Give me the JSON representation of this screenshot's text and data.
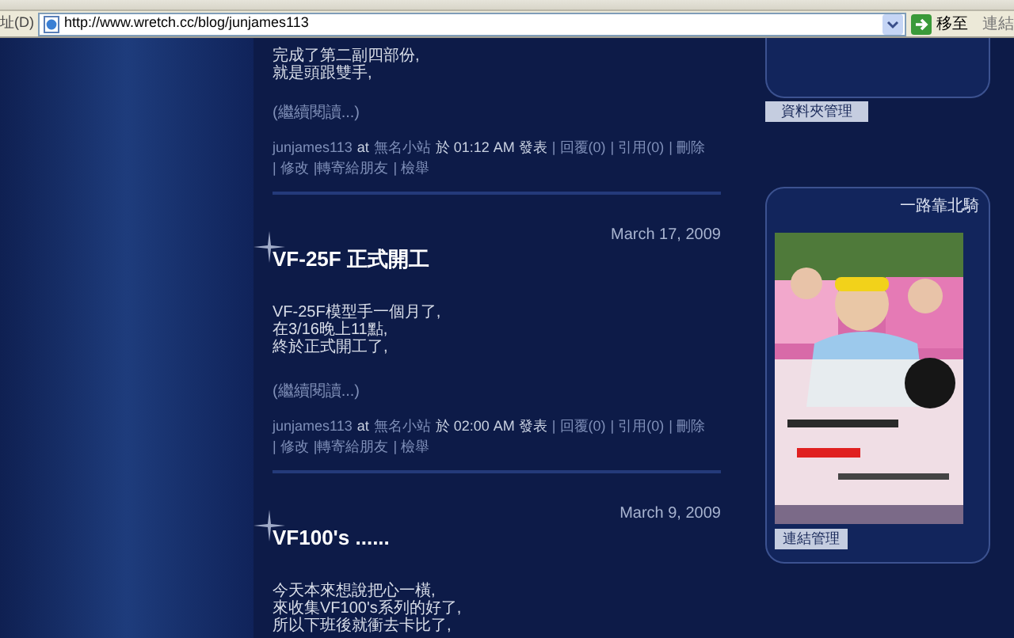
{
  "browser": {
    "address_label": "址(D)",
    "url": "http://www.wretch.cc/blog/junjames113",
    "go_button": "移至",
    "links_label": "連結"
  },
  "posts": [
    {
      "kind": "partial",
      "body": [
        "完成了第二副四部份,",
        "就是頭跟雙手,"
      ],
      "read_more": "(繼續閱讀...)",
      "meta": {
        "author": "junjames113",
        "at": "at",
        "site": "無名小站",
        "time": "於 01:12 AM 發表",
        "actions": [
          "| 回覆(0)",
          "| 引用(0)",
          "| 刪除",
          "| 修改",
          "|轉寄給朋友",
          "| 檢舉"
        ]
      }
    },
    {
      "kind": "full",
      "date": "March 17, 2009",
      "title": "VF-25F 正式開工",
      "body": [
        "VF-25F模型手一個月了,",
        "在3/16晚上11點,",
        "終於正式開工了,"
      ],
      "read_more": "(繼續閱讀...)",
      "meta": {
        "author": "junjames113",
        "at": "at",
        "site": "無名小站",
        "time": "於 02:00 AM 發表",
        "actions": [
          "| 回覆(0)",
          "| 引用(0)",
          "| 刪除",
          "| 修改",
          "|轉寄給朋友",
          "| 檢舉"
        ]
      }
    },
    {
      "kind": "full",
      "date": "March 9, 2009",
      "title": "VF100's ......",
      "body": [
        "今天本來想說把心一橫,",
        "來收集VF100's系列的好了,",
        "所以下班後就衝去卡比了,"
      ]
    }
  ],
  "sidebar": {
    "folder_button": "資料夾管理",
    "panel": {
      "title": "一路靠北騎",
      "button": "連結管理"
    }
  }
}
